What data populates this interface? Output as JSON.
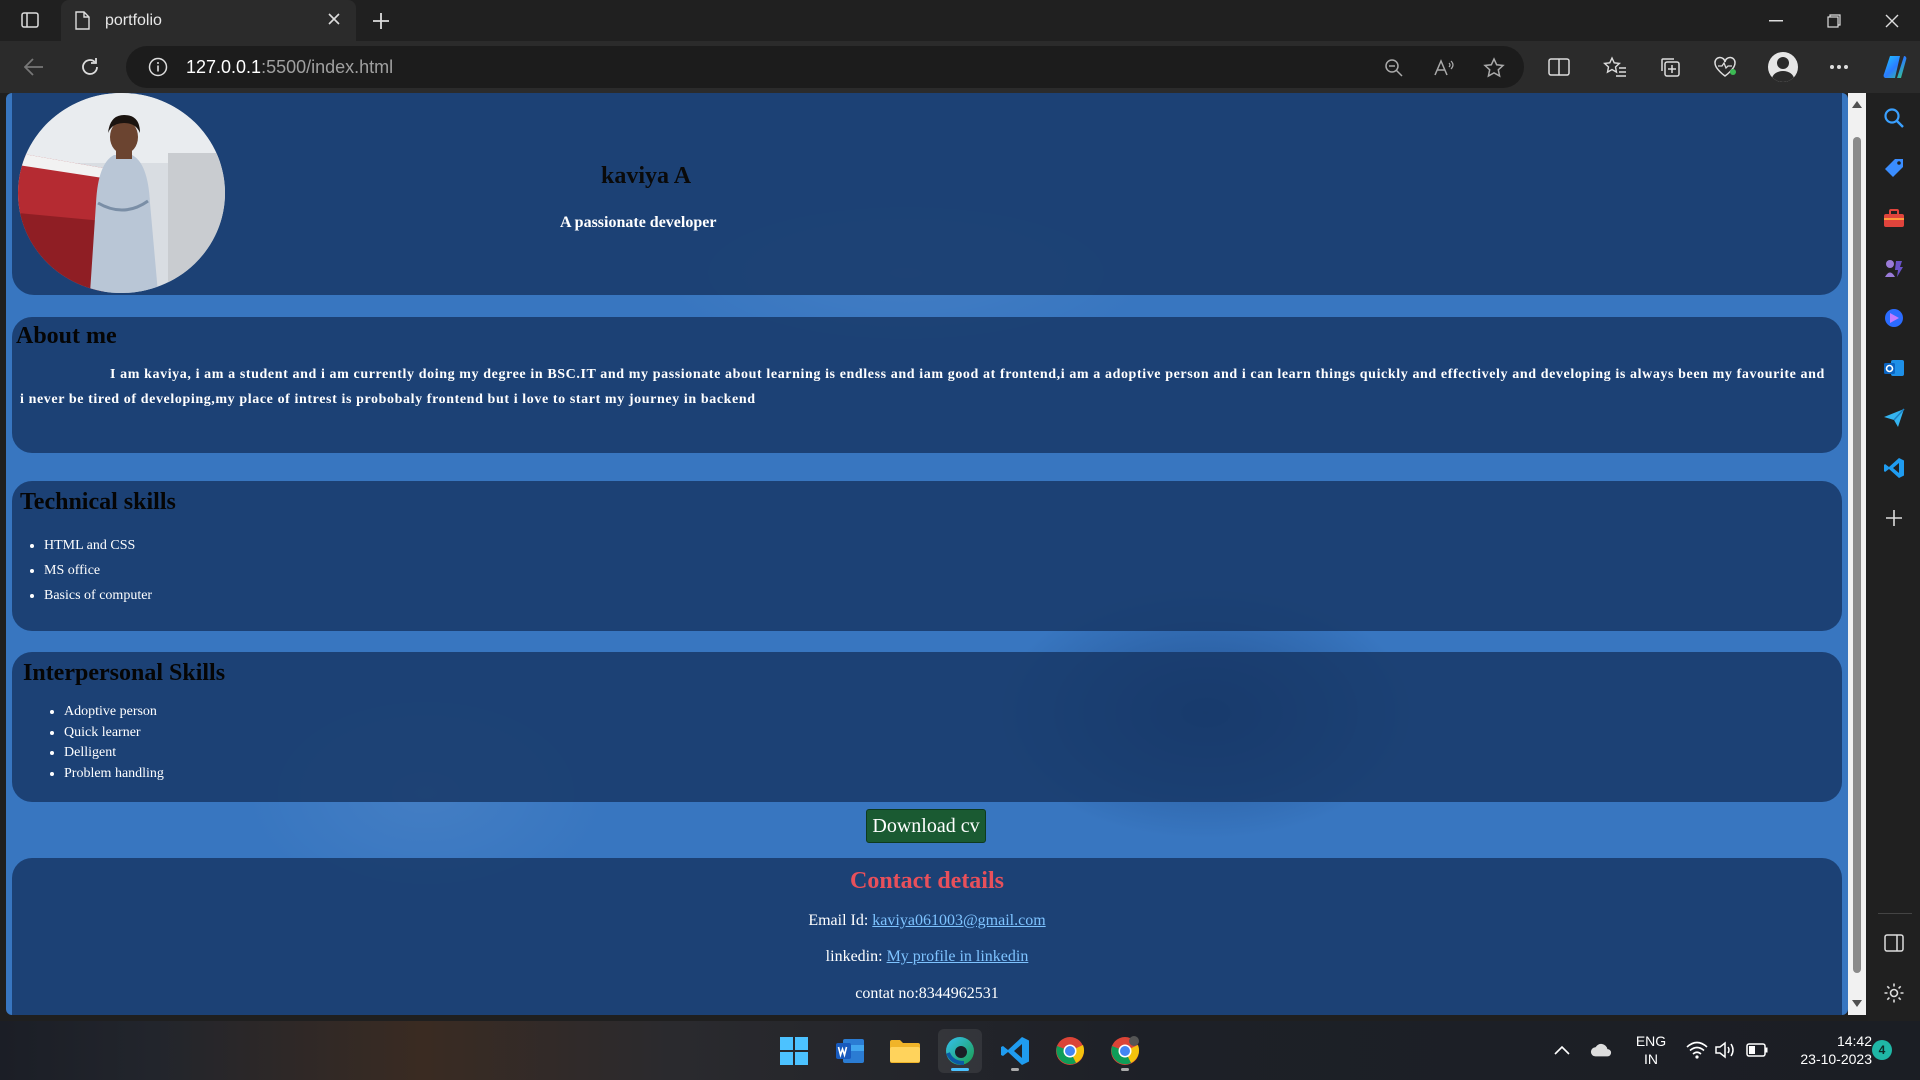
{
  "browser": {
    "tab_title": "portfolio",
    "url_host": "127.0.0.1",
    "url_rest": ":5500/index.html"
  },
  "page": {
    "header": {
      "name": "kaviya A",
      "tagline": "A passionate developer"
    },
    "about": {
      "title": "About me",
      "text": "I am kaviya, i am a student and i am currently doing my degree in BSC.IT and my passionate about learning is endless and iam good at frontend,i am a adoptive person and i can learn things quickly and effectively and developing is always been my favourite and i never be tired of developing,my place of intrest is probobaly frontend but i love to start my journey in backend"
    },
    "technical_skills": {
      "title": "Technical skills",
      "items": [
        "HTML and CSS",
        "MS office",
        "Basics of computer"
      ]
    },
    "interpersonal_skills": {
      "title": "Interpersonal Skills",
      "items": [
        "Adoptive person",
        "Quick learner",
        "Delligent",
        "Problem handling"
      ]
    },
    "download_label": "Download cv",
    "contact": {
      "title": "Contact details",
      "email_label": "Email Id:",
      "email_value": "kaviya061003@gmail.com",
      "linkedin_label": "linkedin:",
      "linkedin_value": "My profile in linkedin",
      "phone_text": "contat no:8344962531"
    }
  },
  "taskbar": {
    "lang_line1": "ENG",
    "lang_line2": "IN",
    "time": "14:42",
    "date": "23-10-2023",
    "notifications": "4"
  },
  "colors": {
    "page_bg": "#3876c0",
    "panel_bg": "#163664",
    "contact_title": "#e8505b",
    "link": "#7ec3ff",
    "download_button": "#1a5a32"
  }
}
